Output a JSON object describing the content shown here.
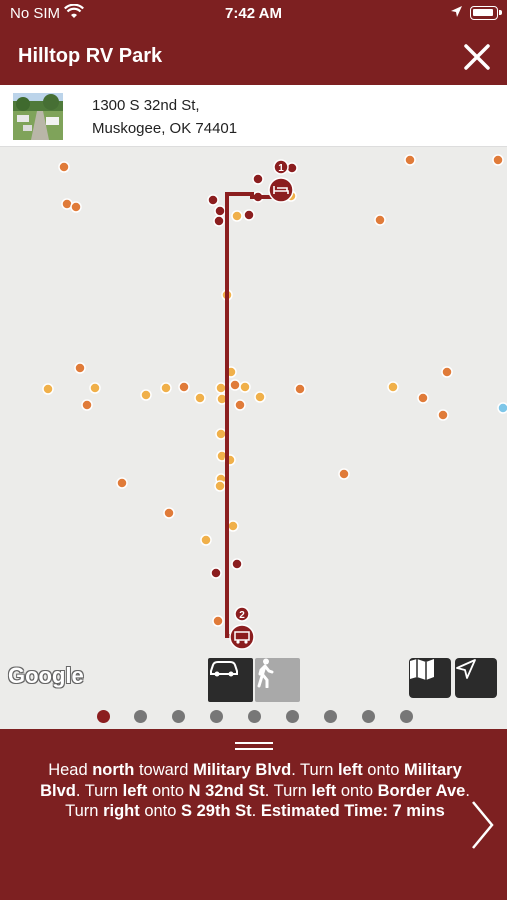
{
  "status_bar": {
    "carrier": "No SIM",
    "time": "7:42 AM"
  },
  "header": {
    "title": "Hilltop RV Park"
  },
  "address": {
    "line1": "1300 S 32nd St,",
    "line2": "Muskogee, OK 74401"
  },
  "map": {
    "provider_logo": "Google",
    "markers": [
      {
        "label": "1",
        "icon": "bed-icon"
      },
      {
        "label": "2",
        "icon": "rv-icon"
      }
    ]
  },
  "travel_modes": [
    {
      "name": "car-icon",
      "active": true
    },
    {
      "name": "walk-icon",
      "active": false
    }
  ],
  "map_controls": [
    {
      "name": "map-icon"
    },
    {
      "name": "navigation-arrow-icon"
    }
  ],
  "pagination": {
    "count": 9,
    "active_index": 0
  },
  "directions": {
    "segments": [
      {
        "t": "Head ",
        "b": false
      },
      {
        "t": "north",
        "b": true
      },
      {
        "t": " toward ",
        "b": false
      },
      {
        "t": "Military Blvd",
        "b": true
      },
      {
        "t": ". Turn ",
        "b": false
      },
      {
        "t": "left",
        "b": true
      },
      {
        "t": " onto ",
        "b": false
      },
      {
        "t": "Military Blvd",
        "b": true
      },
      {
        "t": ". Turn ",
        "b": false
      },
      {
        "t": "left",
        "b": true
      },
      {
        "t": " onto ",
        "b": false
      },
      {
        "t": "N 32nd St",
        "b": true
      },
      {
        "t": ". Turn ",
        "b": false
      },
      {
        "t": "left",
        "b": true
      },
      {
        "t": " onto ",
        "b": false
      },
      {
        "t": "Border Ave",
        "b": true
      },
      {
        "t": ". Turn ",
        "b": false
      },
      {
        "t": "right",
        "b": true
      },
      {
        "t": " onto ",
        "b": false
      },
      {
        "t": "S 29th St",
        "b": true
      },
      {
        "t": ". ",
        "b": false
      }
    ],
    "estimated_time": "Estimated Time: 7 mins"
  },
  "colors": {
    "brand": "#7d2021",
    "route": "#8b1e1f",
    "poi_orange": "#e07b39",
    "poi_yellow": "#f0b04a",
    "poi_red": "#c0392b"
  }
}
